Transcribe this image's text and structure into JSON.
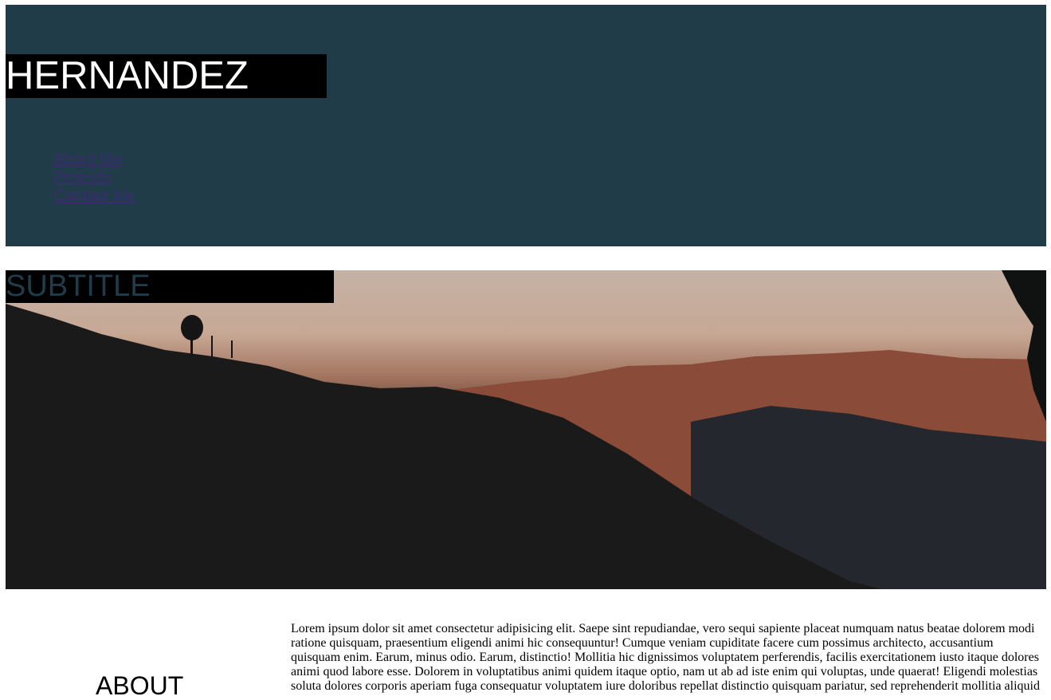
{
  "header": {
    "brand": "HERNANDEZ",
    "nav": [
      {
        "label": "About Me"
      },
      {
        "label": "Projects"
      },
      {
        "label": "Contact Me"
      }
    ],
    "background_color": "#203c49"
  },
  "hero": {
    "subtitle": "SUBTITLE",
    "image": "mountain-sunset-landscape"
  },
  "about": {
    "title": "ABOUT",
    "text": "Lorem ipsum dolor sit amet consectetur adipisicing elit. Saepe sint repudiandae, vero sequi sapiente placeat numquam natus beatae dolorem modi ratione quisquam, praesentium eligendi animi hic consequuntur! Cumque veniam cupiditate facere cum possimus architecto, accusantium quisquam enim. Earum, minus odio. Earum, distinctio! Mollitia hic dignissimos voluptatem perferendis, facilis exercitationem iusto itaque dolores animi quod labore esse. Dolorem in voluptatibus animi quidem itaque optio, nam ut ab ad iste enim qui voluptas, unde quaerat! Eligendi molestias soluta dolores corporis aperiam fuga consequatur voluptatem iure doloribus repellat distinctio quisquam pariatur, sed reprehenderit mollitia aliquid"
  }
}
